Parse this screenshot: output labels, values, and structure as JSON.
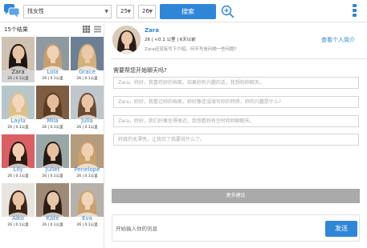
{
  "toolbar": {
    "gender_select": "找女性",
    "age_min": "25",
    "age_max": "26",
    "search_label": "搜索"
  },
  "results": {
    "count_label": "15个结果",
    "members": [
      {
        "name": "Zara",
        "meta": "26 | 0.1公里",
        "selected": true
      },
      {
        "name": "Lola",
        "meta": "26 | 0.1公里"
      },
      {
        "name": "Grace",
        "meta": "26 | 0.1公里"
      },
      {
        "name": "Layla",
        "meta": "26 | 0.1公里"
      },
      {
        "name": "Mila",
        "meta": "26 | 0.1公里"
      },
      {
        "name": "Julia",
        "meta": "26 | 0.1公里"
      },
      {
        "name": "Lily",
        "meta": "26 | 0.1公里"
      },
      {
        "name": "Juliet",
        "meta": "26 | 0.1公里"
      },
      {
        "name": "Penelope",
        "meta": "26 | 0.1公里"
      },
      {
        "name": "Aiko",
        "meta": "26 | 0.1公里"
      },
      {
        "name": "Kate",
        "meta": "26 | 0.1公里"
      },
      {
        "name": "Eva",
        "meta": "26 | 0.1公里"
      }
    ]
  },
  "profile": {
    "name": "Zara",
    "meta": "26 | <0.1 公里 | 6天以前",
    "intro": "Zara还没有写下介绍。何不写信问她一些问题?",
    "view_profile_label": "查看个人简介"
  },
  "chat": {
    "help_title": "需要帮您开始聊天吗?",
    "suggestions": [
      "Zara。妳好，我喜欢妳的档案。如果妳有兴趣的话，我想和妳聊天。",
      "Zara，妳好，我看过妳的档案，妳好像还没填写妳的特质，妳的兴趣是什么?",
      "Zara，妳好，我们好像住得很近，我想看妳有空时和妳聊聊天。",
      "妳真的太漂亮，让我忍了我要说什么了。"
    ],
    "more_label": "更多建议",
    "input_placeholder": "开始输入你的讯息",
    "send_label": "发送"
  },
  "colors": {
    "accent": "#2f86d6",
    "selected_card": "#d5d5d5",
    "more_button": "#aaaaaa"
  }
}
